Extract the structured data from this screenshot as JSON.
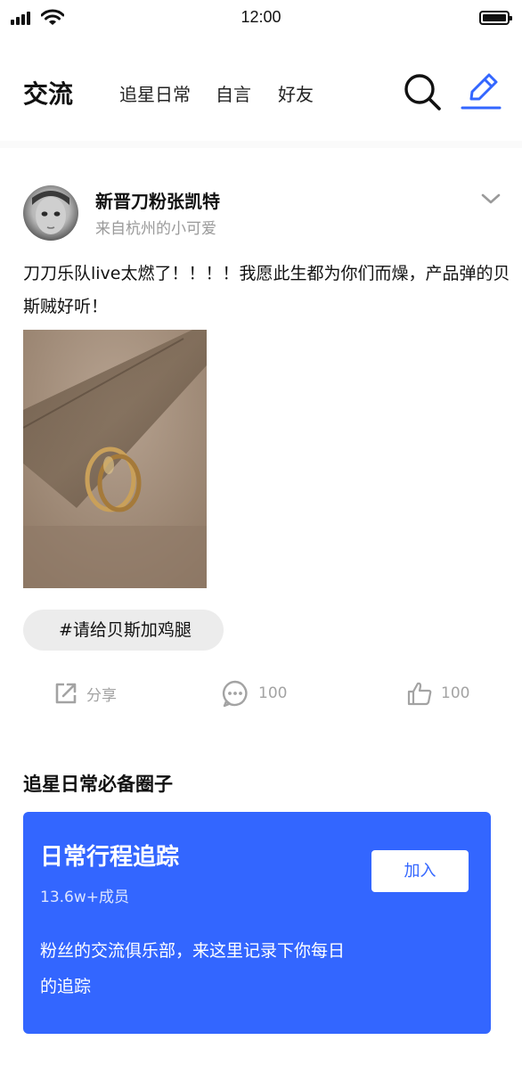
{
  "status_bar": {
    "time": "12:00"
  },
  "header": {
    "title": "交流",
    "tabs": [
      {
        "label": "追星日常"
      },
      {
        "label": "自言"
      },
      {
        "label": "好友"
      }
    ],
    "icons": {
      "search": "search-icon",
      "compose": "edit-pen-icon"
    }
  },
  "post": {
    "author": {
      "name": "新晋刀粉张凯特",
      "subtitle": "来自杭州的小可爱"
    },
    "text": "刀刀乐队live太燃了！！！！我愿此生都为你们而燥，产品弹的贝斯贼好听！",
    "hashtag": "#请给贝斯加鸡腿",
    "actions": {
      "share_label": "分享",
      "comments": "100",
      "likes": "100"
    }
  },
  "circle_section": {
    "title": "追星日常必备圈子",
    "card": {
      "title": "日常行程追踪",
      "members": "13.6w+成员",
      "description": "粉丝的交流俱乐部，来这里记录下你每日的追踪",
      "join_label": "加入"
    }
  },
  "colors": {
    "accent": "#3366ff",
    "muted": "#a3a3a3",
    "tag_bg": "#ececec"
  }
}
